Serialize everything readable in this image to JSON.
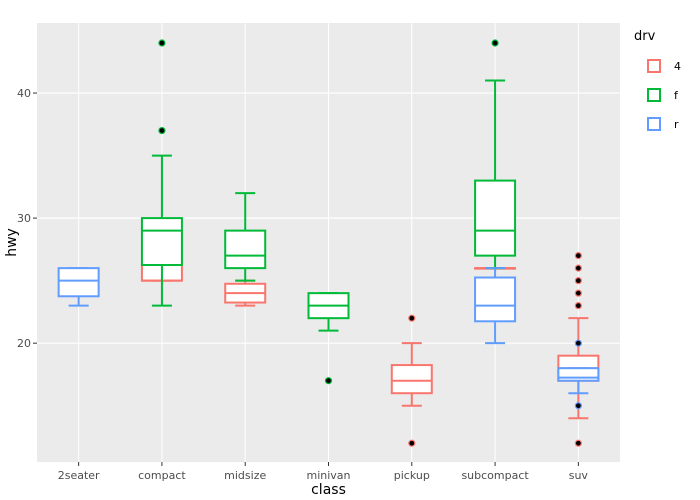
{
  "chart_data": {
    "type": "box",
    "title": "",
    "xlabel": "class",
    "ylabel": "hwy",
    "ylim": [
      10.5,
      45.6
    ],
    "yticks": [
      20,
      30,
      40
    ],
    "ytick_labels": [
      "20",
      "30",
      "40"
    ],
    "categories": [
      "2seater",
      "compact",
      "midsize",
      "minivan",
      "pickup",
      "subcompact",
      "suv"
    ],
    "grid": true,
    "legend": {
      "title": "drv",
      "position": "right"
    },
    "series": [
      {
        "name": "4",
        "color": "#F8766D",
        "boxes": [
          {
            "category": "compact",
            "lower": 25,
            "q1": 25,
            "median": 25,
            "q3": 26.25,
            "upper": 26,
            "outliers": []
          },
          {
            "category": "midsize",
            "lower": 23,
            "q1": 23.25,
            "median": 24,
            "q3": 24.75,
            "upper": 25,
            "outliers": []
          },
          {
            "category": "pickup",
            "lower": 15,
            "q1": 16,
            "median": 17,
            "q3": 18.25,
            "upper": 20,
            "outliers": [
              22,
              12
            ]
          },
          {
            "category": "subcompact",
            "lower": 26,
            "q1": 26,
            "median": 26,
            "q3": 26,
            "upper": 26,
            "outliers": []
          },
          {
            "category": "suv",
            "lower": 14,
            "q1": 17,
            "median": 18,
            "q3": 19,
            "upper": 22,
            "outliers": [
              27,
              26,
              25,
              24,
              23,
              12
            ]
          }
        ]
      },
      {
        "name": "f",
        "color": "#00BA38",
        "boxes": [
          {
            "category": "compact",
            "lower": 23,
            "q1": 26.25,
            "median": 29,
            "q3": 30,
            "upper": 35,
            "outliers": [
              44,
              37
            ]
          },
          {
            "category": "midsize",
            "lower": 25,
            "q1": 26,
            "median": 27,
            "q3": 29,
            "upper": 32,
            "outliers": []
          },
          {
            "category": "minivan",
            "lower": 21,
            "q1": 22,
            "median": 23,
            "q3": 24,
            "upper": 24,
            "outliers": [
              17
            ]
          },
          {
            "category": "subcompact",
            "lower": 26,
            "q1": 27,
            "median": 29,
            "q3": 33,
            "upper": 41,
            "outliers": [
              44
            ]
          }
        ]
      },
      {
        "name": "r",
        "color": "#619CFF",
        "boxes": [
          {
            "category": "2seater",
            "lower": 23,
            "q1": 23.75,
            "median": 25,
            "q3": 26,
            "upper": 26,
            "outliers": []
          },
          {
            "category": "subcompact",
            "lower": 20,
            "q1": 21.75,
            "median": 23,
            "q3": 25.25,
            "upper": 26,
            "outliers": []
          },
          {
            "category": "suv",
            "lower": 16,
            "q1": 17,
            "median": 17.25,
            "q3": 18,
            "upper": 18,
            "outliers": [
              20,
              15
            ]
          }
        ]
      }
    ]
  }
}
